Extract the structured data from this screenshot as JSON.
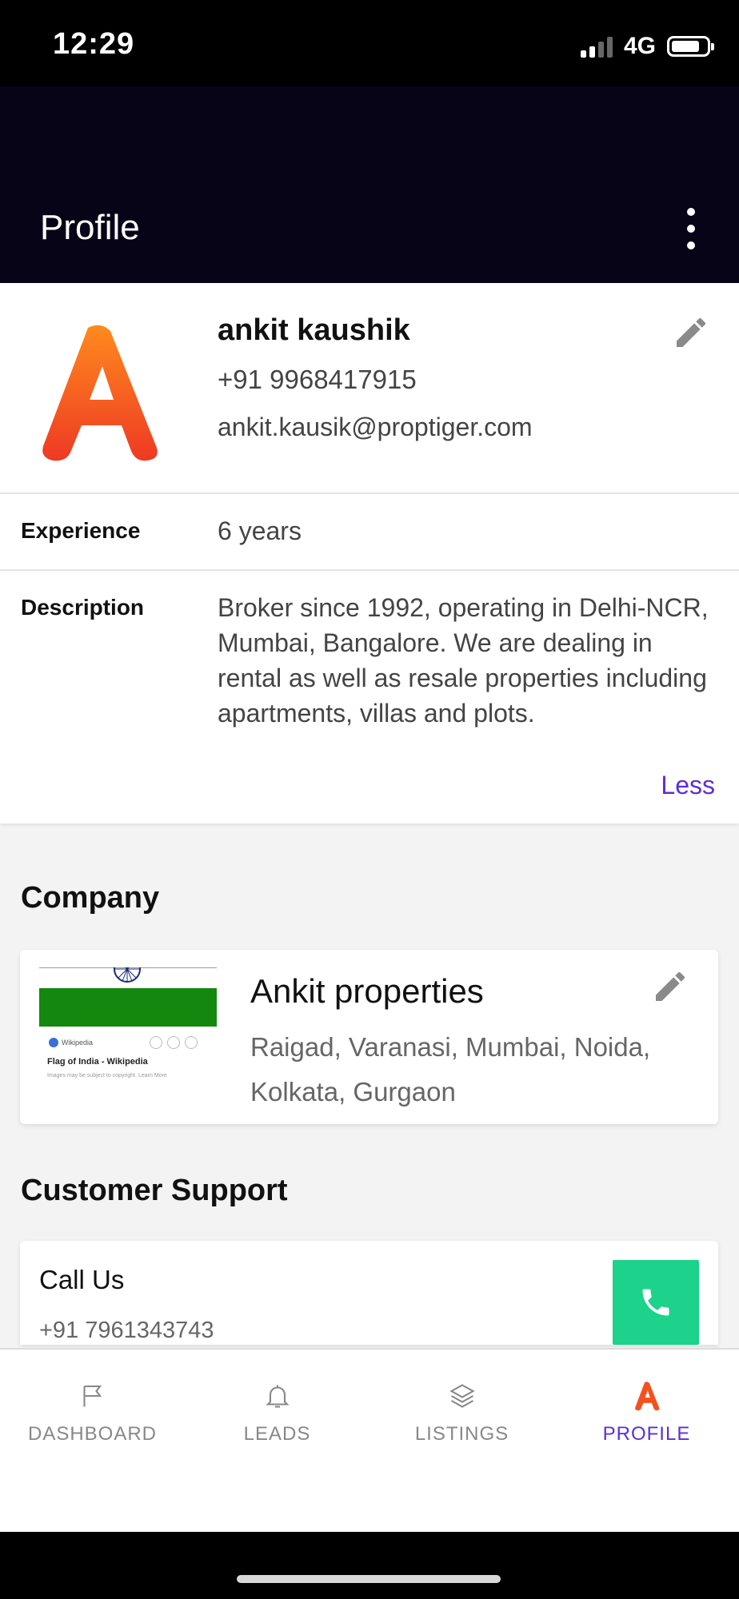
{
  "status_bar": {
    "time": "12:29",
    "network": "4G"
  },
  "header": {
    "title": "Profile"
  },
  "profile": {
    "name": "ankit kaushik",
    "phone": "+91 9968417915",
    "email": "ankit.kausik@proptiger.com",
    "experience_label": "Experience",
    "experience_value": "6 years",
    "description_label": "Description",
    "description_value": "Broker since 1992, operating in Delhi-NCR, Mumbai, Bangalore. We are dealing in rental as well as resale properties including apartments, villas and plots.",
    "less_link": "Less"
  },
  "company_section": {
    "title": "Company",
    "name": "Ankit properties",
    "locations": "Raigad, Varanasi, Mumbai, Noida, Kolkata, Gurgaon",
    "thumbnail": {
      "source": "Wikipedia",
      "caption": "Flag of India - Wikipedia",
      "note": "Images may be subject to copyright. Learn More"
    }
  },
  "support_section": {
    "title": "Customer Support",
    "call_label": "Call Us",
    "phone": "+91 7961343743"
  },
  "bottom_nav": {
    "items": [
      {
        "label": "DASHBOARD",
        "icon": "flag-icon"
      },
      {
        "label": "LEADS",
        "icon": "bell-icon"
      },
      {
        "label": "LISTINGS",
        "icon": "layers-icon"
      },
      {
        "label": "PROFILE",
        "icon": "brand-a-icon",
        "active": true
      }
    ]
  },
  "colors": {
    "header_bg": "#080418",
    "accent": "#5a2fd8",
    "call_button": "#1dd28a",
    "brand_orange": "#f4511e"
  }
}
